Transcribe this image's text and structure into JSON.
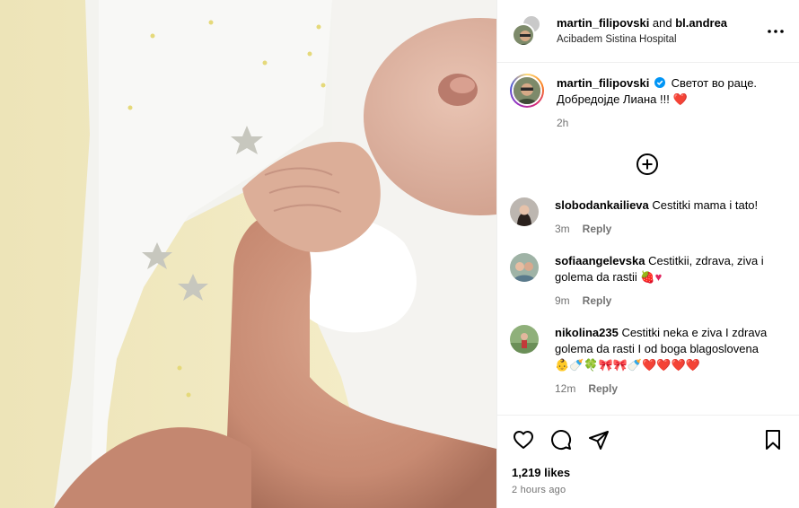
{
  "post": {
    "header": {
      "author": "martin_filipovski",
      "and_text": " and ",
      "collaborator": "bl.andrea",
      "location": "Acibadem Sistina Hospital"
    },
    "caption": {
      "username": "martin_filipovski",
      "line1": "Светот во раце.",
      "line2": "Добредојде Лиана !!!",
      "emoji": "❤️",
      "time": "2h"
    },
    "comments": [
      {
        "username": "slobodankailieva",
        "text": "Cestitki mama i tato!",
        "time": "3m",
        "reply_label": "Reply"
      },
      {
        "username": "sofiaangelevska",
        "text": "Cestitkii, zdrava, ziva i golema da rastii",
        "emoji": "🍓♥",
        "time": "9m",
        "reply_label": "Reply"
      },
      {
        "username": "nikolina235",
        "text": "Cestitki neka e ziva I zdrava golema da rasti I od boga blagoslovena",
        "emoji": "👶🍼🍀🎀🎀🍼❤️❤️❤️❤️",
        "time": "12m",
        "reply_label": "Reply"
      }
    ],
    "likes": "1,219 likes",
    "posted_ago": "2 hours ago",
    "icons": {
      "more": "more-options-icon",
      "verified": "verified-badge-icon",
      "load_more": "plus-circle-icon",
      "like": "heart-icon",
      "comment": "comment-icon",
      "share": "share-icon",
      "save": "bookmark-icon"
    },
    "colors": {
      "verified_blue": "#0095f6",
      "heart_red": "#e0245e",
      "secondary_text": "#737373",
      "divider": "#efefef"
    }
  }
}
